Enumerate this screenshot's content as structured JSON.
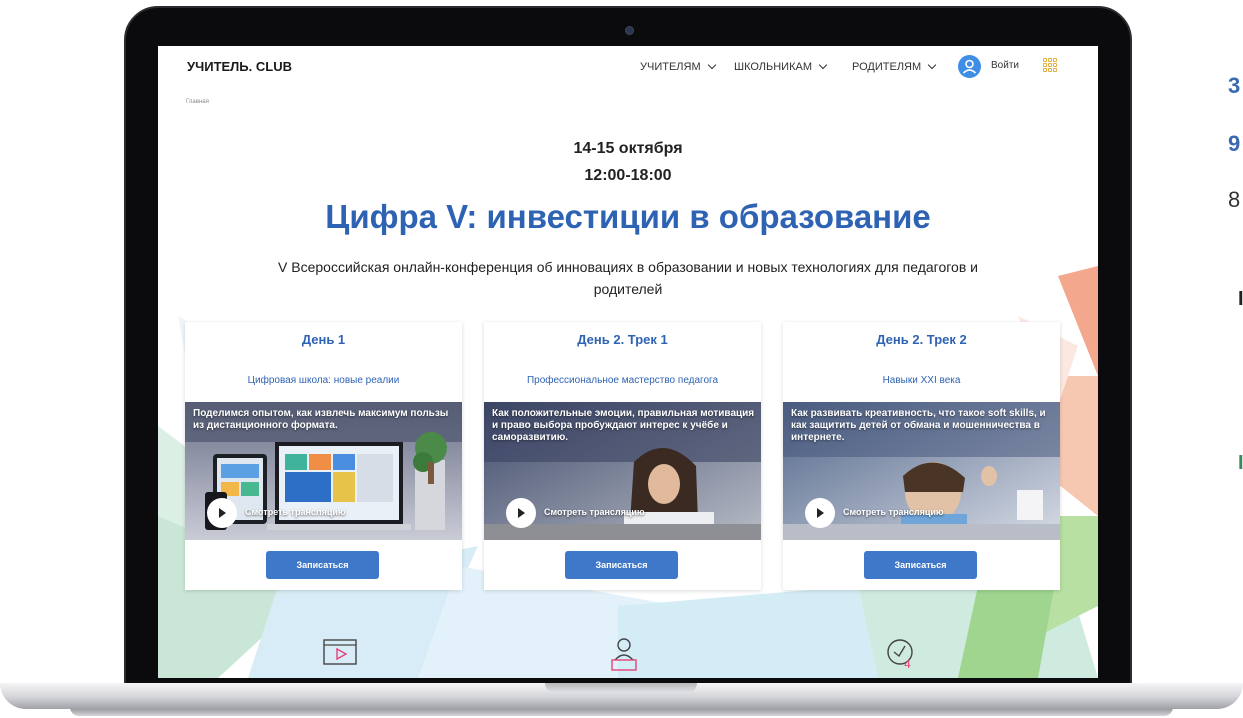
{
  "side_text": {
    "line1": "3",
    "line2": "9",
    "line3": "8",
    "line4": "I",
    "line5": "I"
  },
  "header": {
    "logo": "УЧИТЕЛЬ. CLUB",
    "nav": [
      {
        "label": "УЧИТЕЛЯМ"
      },
      {
        "label": "ШКОЛЬНИКАМ"
      },
      {
        "label": "РОДИТЕЛЯМ"
      }
    ],
    "login_label": "Войти"
  },
  "breadcrumb": "Главная",
  "event": {
    "dates": "14-15 октября",
    "time": "12:00-18:00",
    "title": "Цифра V: инвестиции в образование",
    "subtitle": "V Всероссийская онлайн-конференция об инновациях в образовании и новых технологиях для педагогов и родителей"
  },
  "cards": [
    {
      "day": "День 1",
      "theme": "Цифровая школа: новые реалии",
      "description": "Поделимся опытом, как извлечь максимум пользы из дистанционного формата.",
      "watch_label": "Смотреть трансляцию",
      "signup_label": "Записаться"
    },
    {
      "day": "День 2. Трек 1",
      "theme": "Профессиональное мастерство педагога",
      "description": "Как положительные эмоции, правильная мотивация и право выбора пробуждают интерес к учёбе и саморазвитию.",
      "watch_label": "Смотреть трансляцию",
      "signup_label": "Записаться"
    },
    {
      "day": "День 2. Трек 2",
      "theme": "Навыки XXI века",
      "description": "Как развивать креативность, что такое soft skills, и как защитить детей от обмана и мошенничества в интернете.",
      "watch_label": "Смотреть трансляцию",
      "signup_label": "Записаться"
    }
  ],
  "bottom_icons": [
    {
      "icon": "video-icon"
    },
    {
      "icon": "teacher-desk-icon"
    },
    {
      "icon": "clock-24-icon"
    }
  ],
  "colors": {
    "brand_blue": "#2e63b4",
    "button_blue": "#3f78c8",
    "side_green": "#3a8a5e"
  }
}
